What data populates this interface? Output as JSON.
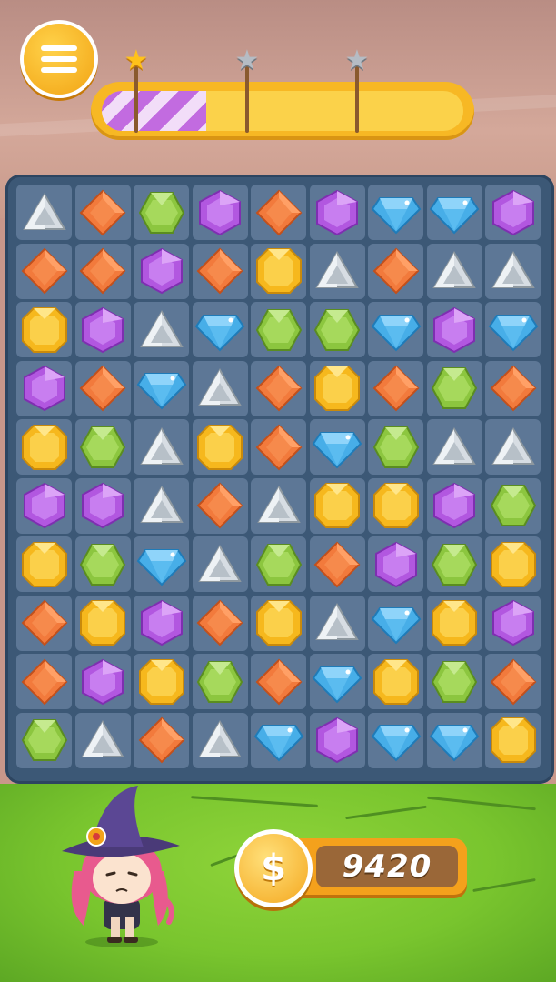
{
  "menu": {
    "icon": "menu-list-icon"
  },
  "progress": {
    "fill_fraction": 0.29,
    "colors": {
      "fill": "#c26be0",
      "track": "#fbd24a"
    },
    "stars": [
      {
        "name": "star-1",
        "earned": true
      },
      {
        "name": "star-2",
        "earned": false
      },
      {
        "name": "star-3",
        "earned": false
      }
    ]
  },
  "board": {
    "gem_colors": {
      "triangle": "silver",
      "orange": "orange",
      "green": "green",
      "purple": "purple",
      "blue": "blue",
      "yellow": "yellow"
    },
    "rows": [
      [
        "triangle",
        "orange",
        "green",
        "purple",
        "orange",
        "purple",
        "blue",
        "blue",
        "purple"
      ],
      [
        "orange",
        "orange",
        "purple",
        "orange",
        "yellow",
        "triangle",
        "orange",
        "triangle",
        "triangle"
      ],
      [
        "yellow",
        "purple",
        "triangle",
        "blue",
        "green",
        "green",
        "blue",
        "purple",
        "blue"
      ],
      [
        "purple",
        "orange",
        "blue",
        "triangle",
        "orange",
        "yellow",
        "orange",
        "green",
        "orange"
      ],
      [
        "yellow",
        "green",
        "triangle",
        "yellow",
        "orange",
        "blue",
        "green",
        "triangle",
        "triangle"
      ],
      [
        "purple",
        "purple",
        "triangle",
        "orange",
        "triangle",
        "yellow",
        "yellow",
        "purple",
        "green"
      ],
      [
        "yellow",
        "green",
        "blue",
        "triangle",
        "green",
        "orange",
        "purple",
        "green",
        "yellow"
      ],
      [
        "orange",
        "yellow",
        "purple",
        "orange",
        "yellow",
        "triangle",
        "blue",
        "yellow",
        "purple"
      ],
      [
        "orange",
        "purple",
        "yellow",
        "green",
        "orange",
        "blue",
        "yellow",
        "green",
        "orange"
      ],
      [
        "green",
        "triangle",
        "orange",
        "triangle",
        "blue",
        "purple",
        "blue",
        "blue",
        "yellow"
      ]
    ]
  },
  "coins": {
    "value": "9420",
    "icon": "dollar-coin-icon",
    "symbol": "$"
  },
  "character": {
    "icon": "witch-character-icon"
  }
}
